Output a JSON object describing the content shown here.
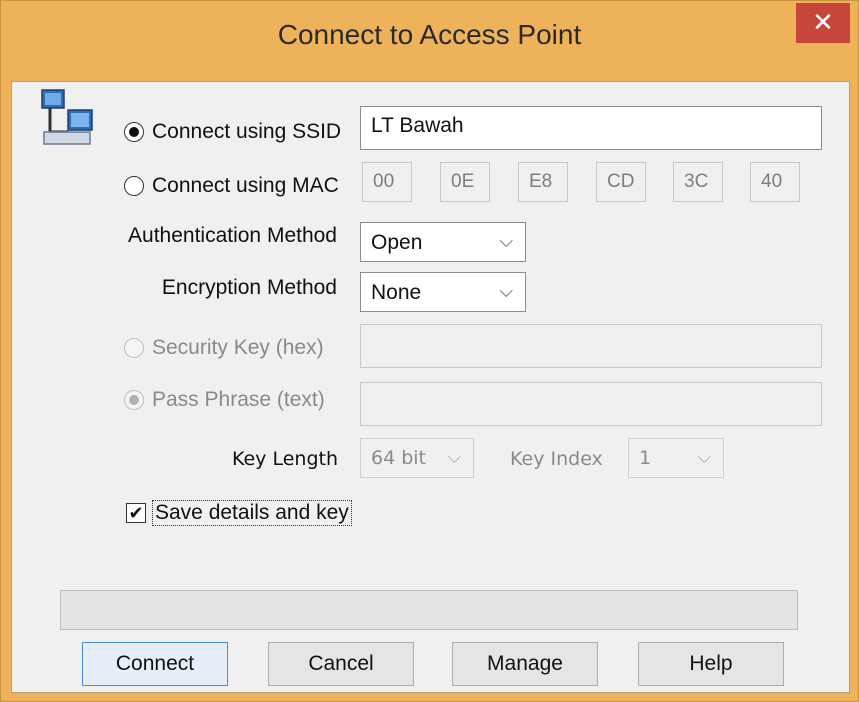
{
  "window": {
    "title": "Connect to Access Point",
    "close_glyph": "✕"
  },
  "ssid": {
    "label": "Connect using SSID",
    "value": "LT Bawah",
    "selected": true
  },
  "mac": {
    "label": "Connect using MAC",
    "octets": [
      "00",
      "0E",
      "E8",
      "CD",
      "3C",
      "40"
    ],
    "selected": false
  },
  "auth": {
    "label": "Authentication Method",
    "value": "Open"
  },
  "encryption": {
    "label": "Encryption Method",
    "value": "None"
  },
  "security_key": {
    "label": "Security Key (hex)",
    "value": ""
  },
  "pass_phrase": {
    "label": "Pass Phrase (text)",
    "value": ""
  },
  "key_length": {
    "label": "Key Length",
    "value": "64 bit"
  },
  "key_index": {
    "label": "Key Index",
    "value": "1"
  },
  "save": {
    "label": "Save details and key",
    "checked": true,
    "check_glyph": "✔"
  },
  "buttons": {
    "connect": "Connect",
    "cancel": "Cancel",
    "manage": "Manage",
    "help": "Help"
  },
  "icons": {
    "network": "network-computers-icon",
    "chevron": "chevron-down-icon"
  }
}
